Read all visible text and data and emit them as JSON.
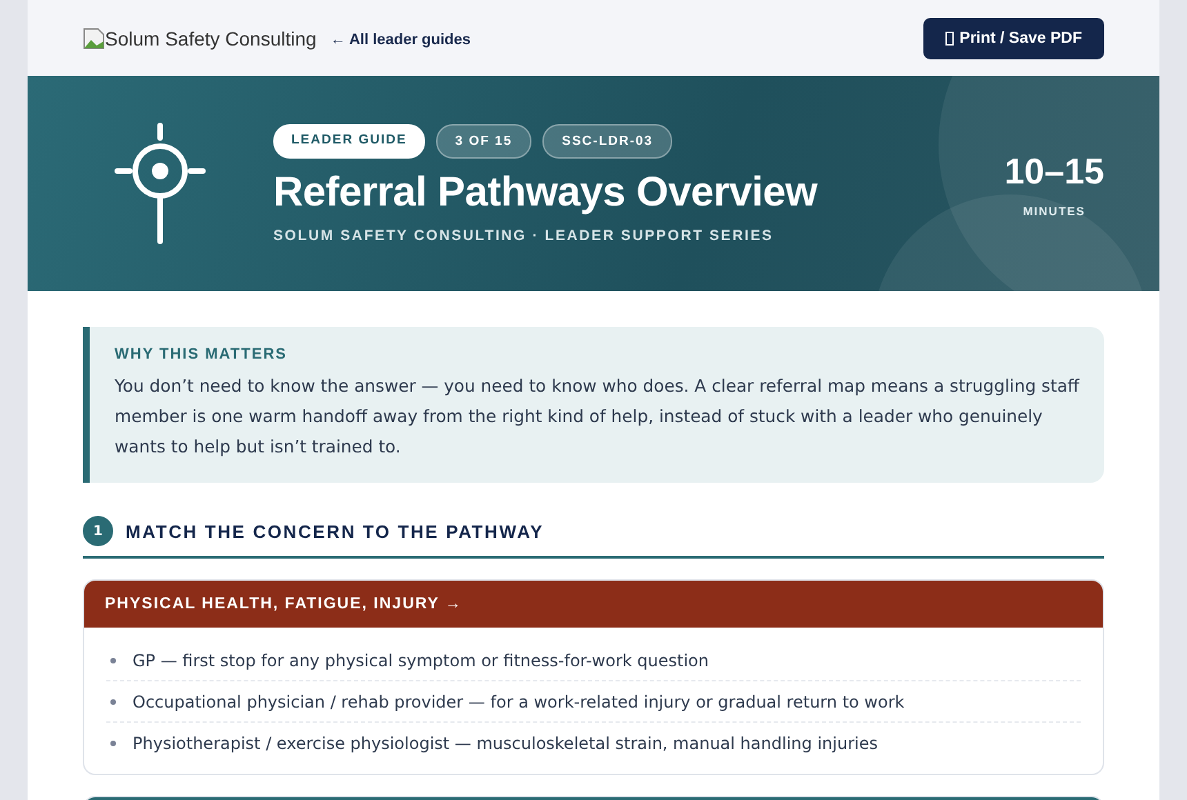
{
  "topbar": {
    "logo_alt": "Solum Safety Consulting",
    "back_link": "← All leader guides",
    "print_button": "Print / Save PDF"
  },
  "hero": {
    "tags": [
      {
        "label": "LEADER GUIDE",
        "kind": "solid"
      },
      {
        "label": "3 OF 15",
        "kind": "outline"
      },
      {
        "label": "SSC-LDR-03",
        "kind": "outline"
      }
    ],
    "title": "Referral Pathways Overview",
    "subtitle": "SOLUM SAFETY CONSULTING · LEADER SUPPORT SERIES",
    "duration": "10–15",
    "duration_unit": "MINUTES"
  },
  "callout": {
    "heading": "WHY THIS MATTERS",
    "text": "You don’t need to know the answer — you need to know who does. A clear referral map means a struggling staff member is one warm handoff away from the right kind of help, instead of stuck with a leader who genuinely wants to help but isn’t trained to."
  },
  "section": {
    "number": "1",
    "title": "MATCH THE CONCERN TO THE PATHWAY"
  },
  "cards": [
    {
      "title": "PHYSICAL HEALTH, FATIGUE, INJURY →",
      "color": "#8c2d18",
      "items": [
        "GP — first stop for any physical symptom or fitness-for-work question",
        "Occupational physician / rehab provider — for a work-related injury or gradual return to work",
        "Physiotherapist / exercise physiologist — musculoskeletal strain, manual handling injuries"
      ]
    },
    {
      "color": "#2a6b74"
    }
  ]
}
